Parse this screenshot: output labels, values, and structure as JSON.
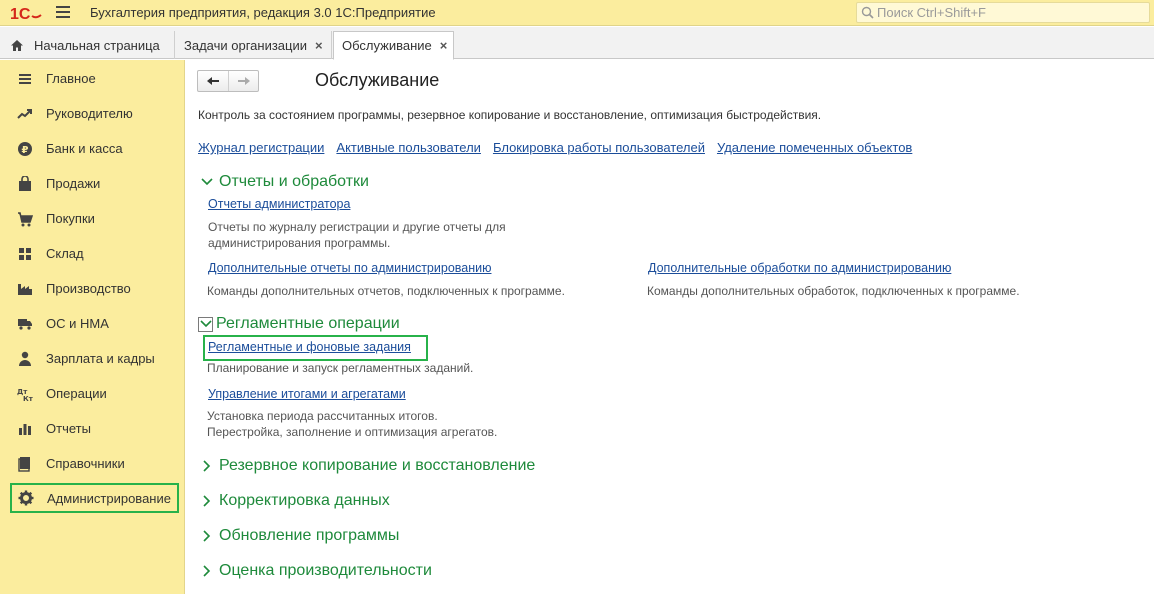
{
  "app": {
    "title": "Бухгалтерия предприятия, редакция 3.0 1С:Предприятие",
    "search_placeholder": "Поиск Ctrl+Shift+F"
  },
  "tabs": [
    {
      "label": "Начальная страница"
    },
    {
      "label": "Задачи организации",
      "close": "×"
    },
    {
      "label": "Обслуживание",
      "close": "×"
    }
  ],
  "sidebar": {
    "items": [
      {
        "label": "Главное",
        "icon": "list-icon"
      },
      {
        "label": "Руководителю",
        "icon": "trend-icon"
      },
      {
        "label": "Банк и касса",
        "icon": "ruble-icon"
      },
      {
        "label": "Продажи",
        "icon": "bag-icon"
      },
      {
        "label": "Покупки",
        "icon": "cart-icon"
      },
      {
        "label": "Склад",
        "icon": "warehouse-icon"
      },
      {
        "label": "Производство",
        "icon": "factory-icon"
      },
      {
        "label": "ОС и НМА",
        "icon": "truck-icon"
      },
      {
        "label": "Зарплата и кадры",
        "icon": "person-icon"
      },
      {
        "label": "Операции",
        "icon": "dt-kt-icon"
      },
      {
        "label": "Отчеты",
        "icon": "bar-chart-icon"
      },
      {
        "label": "Справочники",
        "icon": "book-icon"
      },
      {
        "label": "Администрирование",
        "icon": "gear-icon",
        "active": true
      }
    ]
  },
  "main": {
    "title": "Обслуживание",
    "description": "Контроль за состоянием программы, резервное копирование и восстановление, оптимизация быстродействия.",
    "top_links": [
      "Журнал регистрации",
      "Активные пользователи",
      "Блокировка работы пользователей",
      "Удаление помеченных объектов"
    ],
    "groups": [
      {
        "title": "Отчеты и обработки",
        "expanded": true,
        "items": [
          {
            "link": "Отчеты администратора",
            "desc": [
              "Отчеты по журналу регистрации и другие отчеты для",
              "администрирования программы."
            ]
          },
          {
            "link": "Дополнительные отчеты по администрированию",
            "desc": [
              "Команды дополнительных отчетов, подключенных к программе."
            ]
          },
          {
            "link": "Дополнительные обработки по администрированию",
            "desc": [
              "Команды дополнительных обработок, подключенных к программе."
            ]
          }
        ]
      },
      {
        "title": "Регламентные операции",
        "expanded": true,
        "items": [
          {
            "link": "Регламентные и фоновые задания",
            "desc": [
              "Планирование и запуск регламентных заданий."
            ]
          },
          {
            "link": "Управление итогами и агрегатами",
            "desc": [
              "Установка периода рассчитанных итогов.",
              "Перестройка, заполнение и оптимизация агрегатов."
            ]
          }
        ]
      },
      {
        "title": "Резервное копирование и восстановление",
        "expanded": false
      },
      {
        "title": "Корректировка данных",
        "expanded": false
      },
      {
        "title": "Обновление программы",
        "expanded": false
      },
      {
        "title": "Оценка производительности",
        "expanded": false
      }
    ]
  },
  "colors": {
    "accent_yellow": "#fbed9e",
    "group_green": "#1e8a3b",
    "link_blue": "#1b4d9a",
    "highlight_green": "#27b24a",
    "logo_red": "#d5281b"
  }
}
